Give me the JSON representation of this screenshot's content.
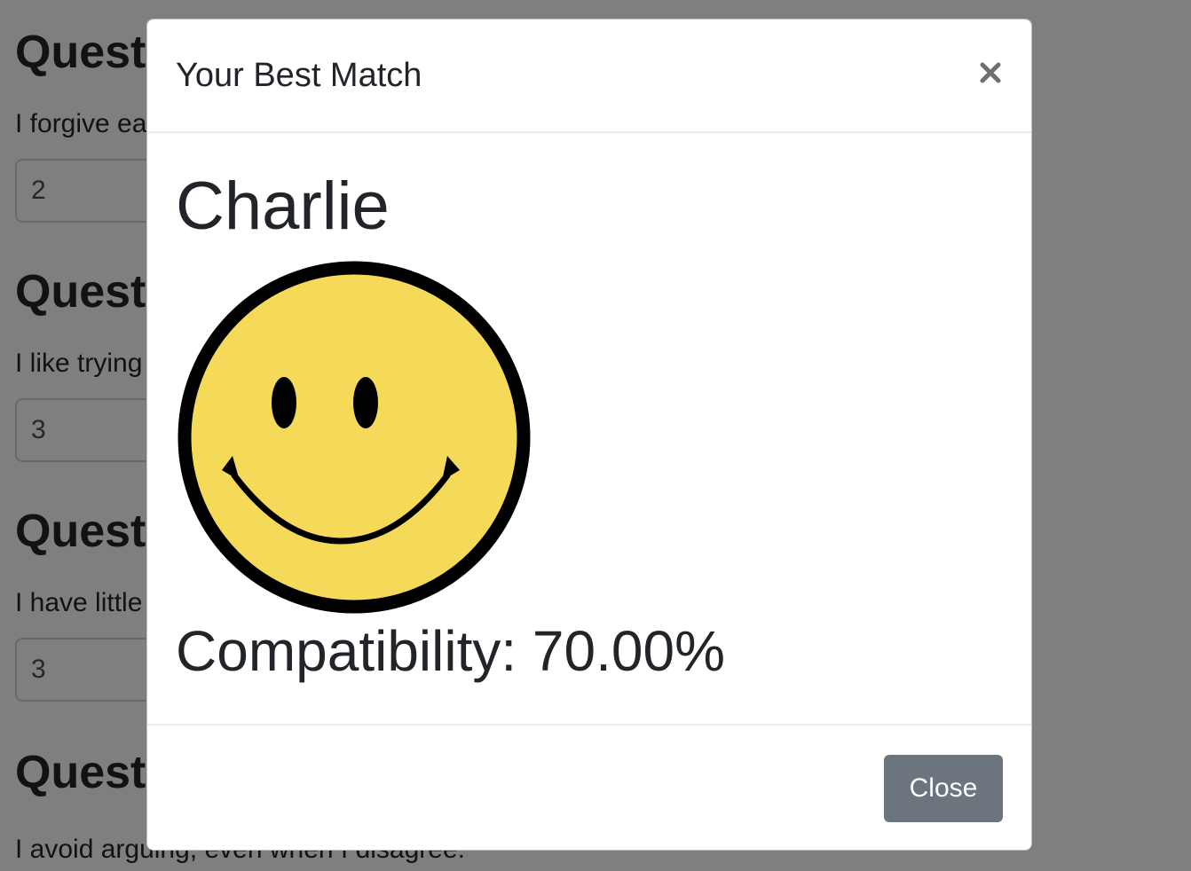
{
  "background": {
    "questions": [
      {
        "heading": "Question",
        "text": "I forgive easily.",
        "answer": "2"
      },
      {
        "heading": "Question",
        "text": "I like trying new things.",
        "answer": "3"
      },
      {
        "heading": "Question",
        "text": "I have little to say.",
        "answer": "3"
      },
      {
        "heading": "Question",
        "text": "I avoid arguing, even when I disagree.",
        "answer": ""
      }
    ]
  },
  "modal": {
    "title": "Your Best Match",
    "close_icon": "close-icon",
    "match_name": "Charlie",
    "photo_icon": "smiley-face",
    "compatibility_text": "Compatibility: 70.00%",
    "compatibility_value": 70.0,
    "close_button_label": "Close"
  },
  "colors": {
    "backdrop": "#000000",
    "smiley_fill": "#F5DA5A",
    "close_button": "#6c757d"
  }
}
